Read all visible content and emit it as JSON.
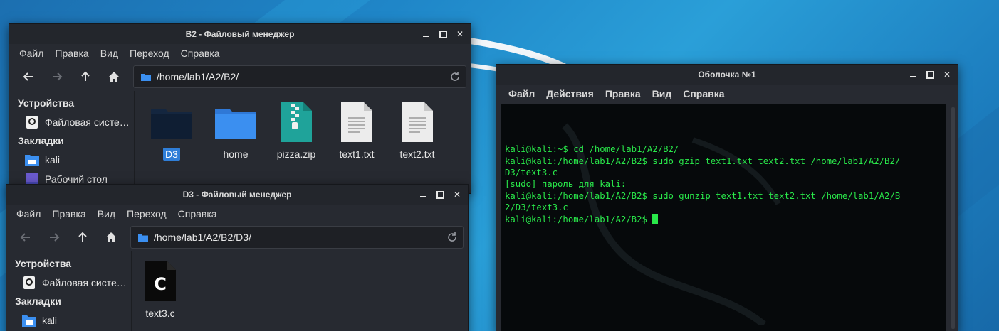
{
  "fm_b2": {
    "title": "B2 - Файловый менеджер",
    "menu": [
      "Файл",
      "Правка",
      "Вид",
      "Переход",
      "Справка"
    ],
    "path": "/home/lab1/A2/B2/",
    "sidebar": {
      "devices_header": "Устройства",
      "devices": [
        {
          "label": "Файловая систе…",
          "icon": "drive-icon"
        }
      ],
      "bookmarks_header": "Закладки",
      "bookmarks": [
        {
          "label": "kali",
          "icon": "home-folder-icon"
        },
        {
          "label": "Рабочий стол",
          "icon": "desktop-icon"
        }
      ]
    },
    "files": [
      {
        "name": "D3",
        "icon": "folder-icon",
        "selected": true
      },
      {
        "name": "home",
        "icon": "folder-icon",
        "selected": false
      },
      {
        "name": "pizza.zip",
        "icon": "zip-icon",
        "selected": false
      },
      {
        "name": "text1.txt",
        "icon": "text-file-icon",
        "selected": false
      },
      {
        "name": "text2.txt",
        "icon": "text-file-icon",
        "selected": false
      }
    ]
  },
  "fm_d3": {
    "title": "D3 - Файловый менеджер",
    "menu": [
      "Файл",
      "Правка",
      "Вид",
      "Переход",
      "Справка"
    ],
    "path": "/home/lab1/A2/B2/D3/",
    "sidebar": {
      "devices_header": "Устройства",
      "devices": [
        {
          "label": "Файловая систе…",
          "icon": "drive-icon"
        }
      ],
      "bookmarks_header": "Закладки",
      "bookmarks": [
        {
          "label": "kali",
          "icon": "home-folder-icon"
        }
      ]
    },
    "files": [
      {
        "name": "text3.c",
        "icon": "c-source-icon",
        "selected": false
      }
    ]
  },
  "terminal": {
    "title": "Оболочка №1",
    "menu": [
      "Файл",
      "Действия",
      "Правка",
      "Вид",
      "Справка"
    ],
    "lines": [
      "kali@kali:~$ cd /home/lab1/A2/B2/",
      "kali@kali:/home/lab1/A2/B2$ sudo gzip text1.txt text2.txt /home/lab1/A2/B2/",
      "D3/text3.c",
      "[sudo] пароль для kali:",
      "kali@kali:/home/lab1/A2/B2$ sudo gunzip text1.txt text2.txt /home/lab1/A2/B",
      "2/D3/text3.c",
      "kali@kali:/home/lab1/A2/B2$ "
    ]
  },
  "colors": {
    "accent": "#2f7ed8",
    "folder": "#3b8ff0",
    "terminal_text": "#29e84a",
    "window_bg": "#272a31"
  }
}
